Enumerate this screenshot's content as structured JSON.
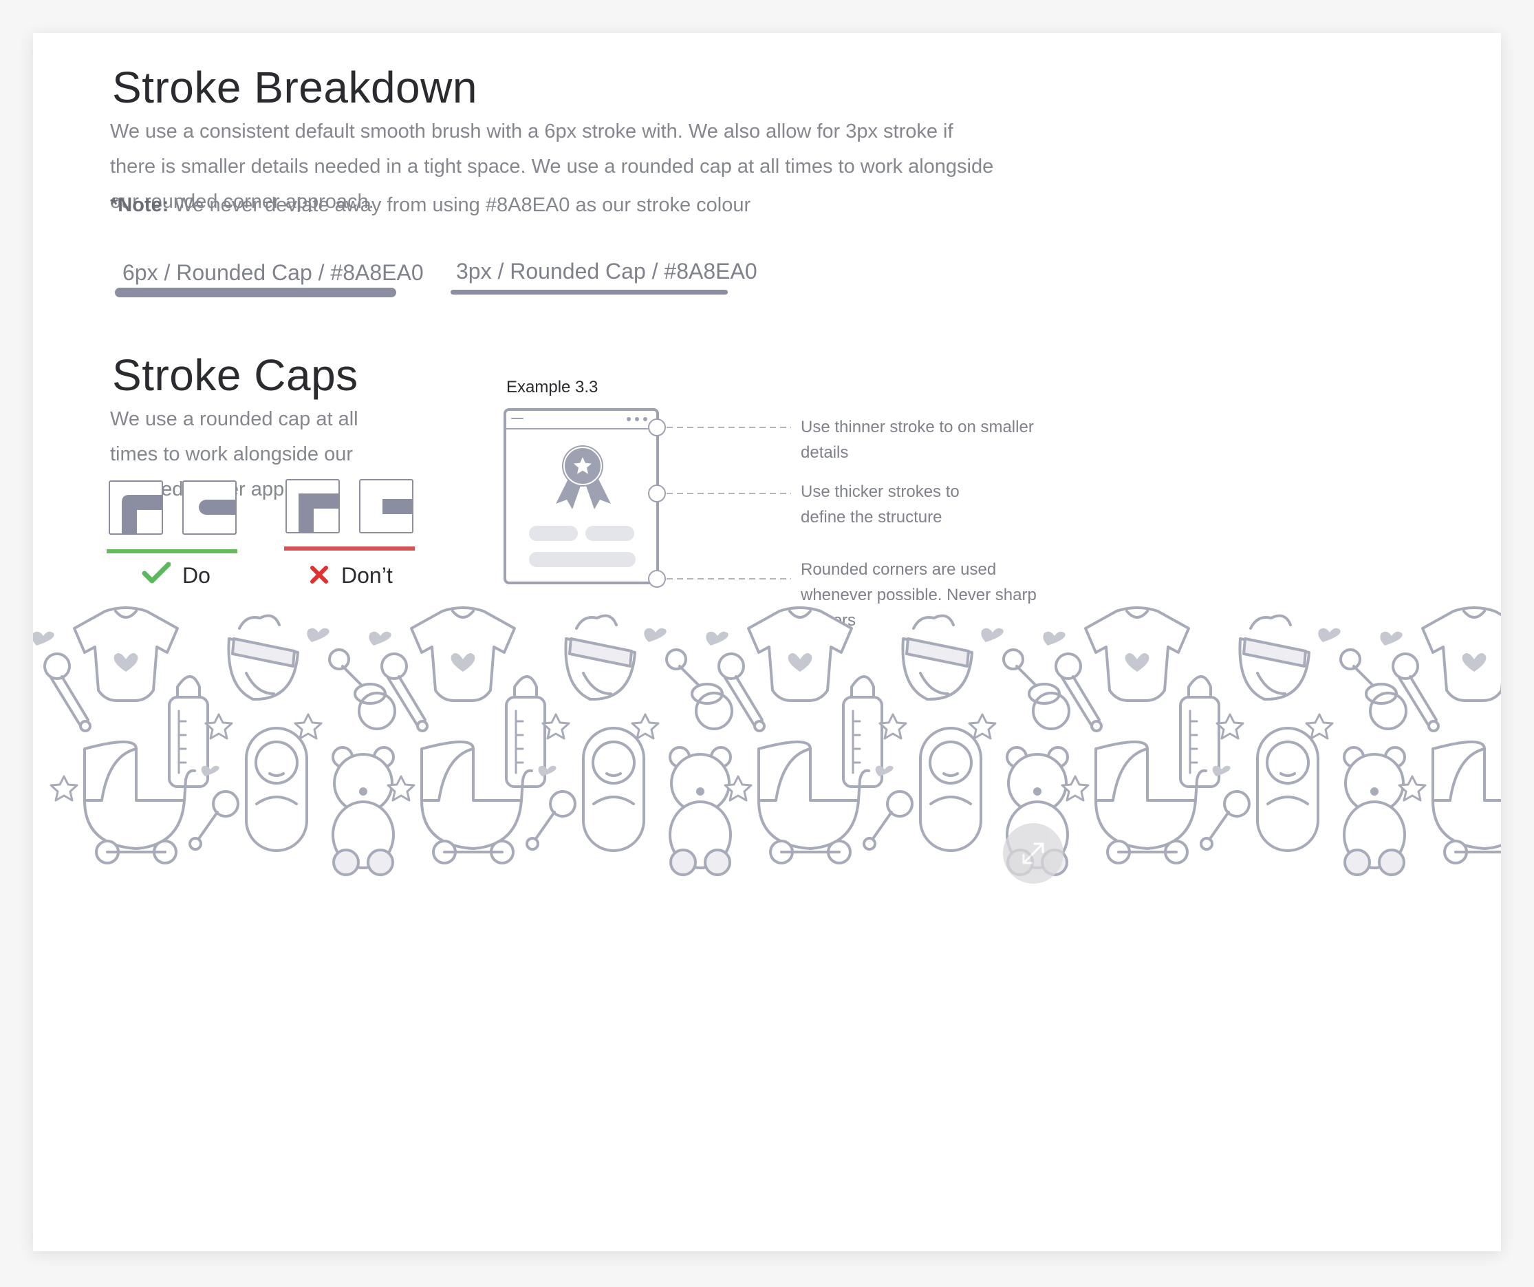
{
  "breakdown": {
    "title": "Stroke Breakdown",
    "description": "We use a consistent default smooth brush with a 6px stroke with. We also allow for 3px stroke if there is smaller details needed  in a tight space. We use a rounded cap at all times to work alongside our rounded corner approach.",
    "note_label": "*Note:",
    "note_text": " We never deviate away from using #8A8EA0 as our stroke colour",
    "thick_label": "6px / Rounded Cap / #8A8EA0",
    "thin_label": "3px / Rounded Cap / #8A8EA0"
  },
  "caps": {
    "title": "Stroke Caps",
    "description": "We use a rounded cap at all times to work alongside our rounded corner approach.",
    "do_label": "Do",
    "dont_label": "Don’t"
  },
  "example": {
    "title": "Example 3.3",
    "annotations": [
      "Use thinner stroke to on smaller details",
      "Use thicker strokes to define the structure",
      "Rounded corners are used whenever possible. Never sharp corners"
    ]
  },
  "colors": {
    "stroke": "#8A8EA0",
    "do": "#66bb5c",
    "dont": "#d65252",
    "check": "#5cb85c",
    "cross": "#e03131"
  },
  "icons": [
    "check-icon",
    "cross-icon",
    "expand-icon"
  ]
}
